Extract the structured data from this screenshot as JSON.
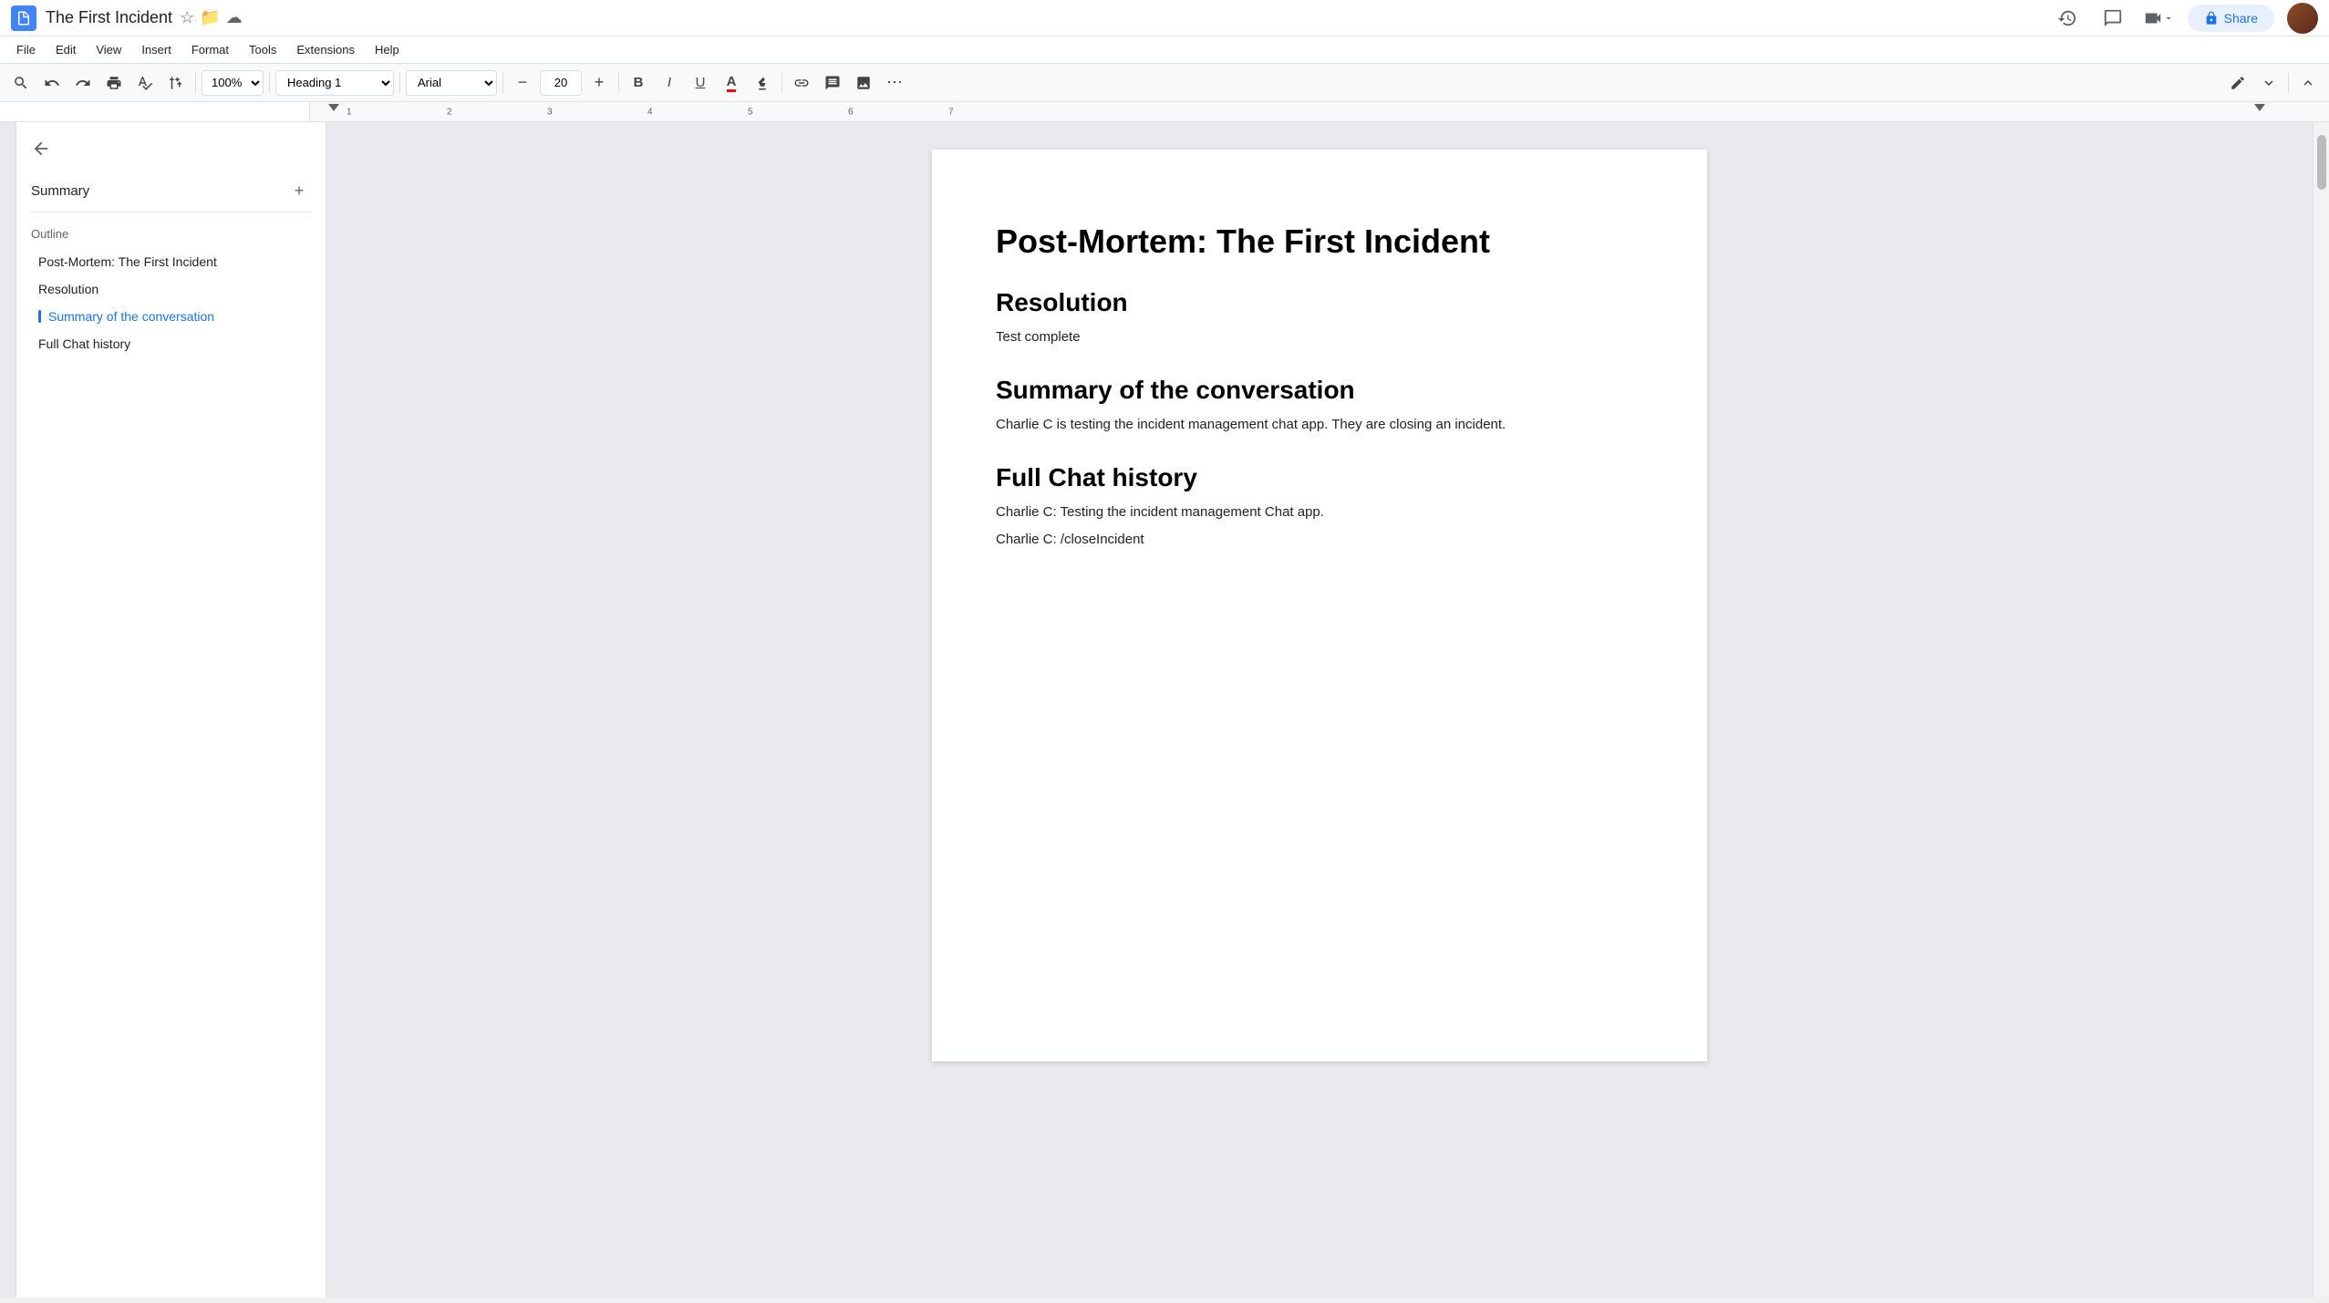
{
  "titleBar": {
    "docTitle": "The First Incident",
    "icons": [
      "☆",
      "📁",
      "☁"
    ],
    "shareLabel": "Share",
    "rightIcons": [
      "history",
      "comment",
      "video"
    ]
  },
  "menuBar": {
    "items": [
      "File",
      "Edit",
      "View",
      "Insert",
      "Format",
      "Tools",
      "Extensions",
      "Help"
    ]
  },
  "toolbar": {
    "zoom": "100%",
    "style": "Heading 1",
    "font": "Arial",
    "fontSize": "20",
    "buttons": {
      "undo": "↩",
      "redo": "↪",
      "print": "🖨",
      "spellcheck": "✓",
      "paintFormat": "🖌",
      "bold": "B",
      "italic": "I",
      "underline": "U",
      "textColor": "A",
      "highlight": "✏",
      "link": "🔗",
      "insertComment": "💬",
      "insertImage": "🖼",
      "more": "⋯"
    }
  },
  "sidebar": {
    "backArrow": "←",
    "summaryLabel": "Summary",
    "addLabel": "+",
    "outlineLabel": "Outline",
    "outlineItems": [
      {
        "label": "Post-Mortem: The First Incident",
        "active": false
      },
      {
        "label": "Resolution",
        "active": false
      },
      {
        "label": "Summary of the conversation",
        "active": true
      },
      {
        "label": "Full Chat history",
        "active": false
      }
    ]
  },
  "document": {
    "mainTitle": "Post-Mortem: The First Incident",
    "sections": [
      {
        "heading": "Resolution",
        "body": [
          "Test complete"
        ]
      },
      {
        "heading": "Summary of the conversation",
        "body": [
          "Charlie C is testing the incident management chat app. They are closing an incident."
        ]
      },
      {
        "heading": "Full Chat history",
        "body": [
          "Charlie C: Testing the incident management Chat app.",
          "Charlie C: /closeIncident"
        ]
      }
    ]
  }
}
